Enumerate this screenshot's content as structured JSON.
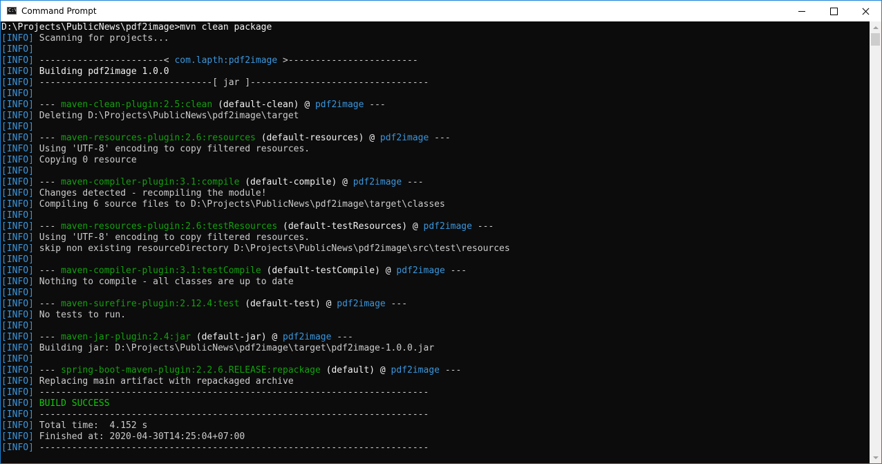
{
  "window": {
    "title": "Command Prompt",
    "icon_text": "C:\\",
    "icon_name": "command-prompt-icon"
  },
  "controls": {
    "minimize": "minimize-icon",
    "maximize": "maximize-icon",
    "close": "close-icon"
  },
  "colors": {
    "info": "#3a96dd",
    "plugin": "#13a10e",
    "artifact": "#3a96dd",
    "success": "#16c60c",
    "text": "#cccccc",
    "background": "#0c0c0c"
  },
  "console": {
    "lines": [
      [
        {
          "t": "D:\\Projects\\PublicNews\\pdf2image>mvn clean package",
          "c": "bright"
        }
      ],
      [
        {
          "t": "[INFO]",
          "c": "info"
        },
        {
          "t": " Scanning for projects...",
          "c": ""
        }
      ],
      [
        {
          "t": "[INFO]",
          "c": "info"
        }
      ],
      [
        {
          "t": "[INFO]",
          "c": "info"
        },
        {
          "t": " -----------------------< ",
          "c": ""
        },
        {
          "t": "com.lapth:pdf2image",
          "c": "artifact"
        },
        {
          "t": " >------------------------",
          "c": ""
        }
      ],
      [
        {
          "t": "[INFO]",
          "c": "info"
        },
        {
          "t": " Building pdf2image 1.0.0",
          "c": "bright"
        }
      ],
      [
        {
          "t": "[INFO]",
          "c": "info"
        },
        {
          "t": " --------------------------------[ jar ]---------------------------------",
          "c": ""
        }
      ],
      [
        {
          "t": "[INFO]",
          "c": "info"
        }
      ],
      [
        {
          "t": "[INFO]",
          "c": "info"
        },
        {
          "t": " --- ",
          "c": ""
        },
        {
          "t": "maven-clean-plugin:2.5:clean",
          "c": "plugin"
        },
        {
          "t": " (default-clean) @ ",
          "c": "bright"
        },
        {
          "t": "pdf2image",
          "c": "artifact"
        },
        {
          "t": " ---",
          "c": ""
        }
      ],
      [
        {
          "t": "[INFO]",
          "c": "info"
        },
        {
          "t": " Deleting D:\\Projects\\PublicNews\\pdf2image\\target",
          "c": ""
        }
      ],
      [
        {
          "t": "[INFO]",
          "c": "info"
        }
      ],
      [
        {
          "t": "[INFO]",
          "c": "info"
        },
        {
          "t": " --- ",
          "c": ""
        },
        {
          "t": "maven-resources-plugin:2.6:resources",
          "c": "plugin"
        },
        {
          "t": " (default-resources) @ ",
          "c": "bright"
        },
        {
          "t": "pdf2image",
          "c": "artifact"
        },
        {
          "t": " ---",
          "c": ""
        }
      ],
      [
        {
          "t": "[INFO]",
          "c": "info"
        },
        {
          "t": " Using 'UTF-8' encoding to copy filtered resources.",
          "c": ""
        }
      ],
      [
        {
          "t": "[INFO]",
          "c": "info"
        },
        {
          "t": " Copying 0 resource",
          "c": ""
        }
      ],
      [
        {
          "t": "[INFO]",
          "c": "info"
        }
      ],
      [
        {
          "t": "[INFO]",
          "c": "info"
        },
        {
          "t": " --- ",
          "c": ""
        },
        {
          "t": "maven-compiler-plugin:3.1:compile",
          "c": "plugin"
        },
        {
          "t": " (default-compile) @ ",
          "c": "bright"
        },
        {
          "t": "pdf2image",
          "c": "artifact"
        },
        {
          "t": " ---",
          "c": ""
        }
      ],
      [
        {
          "t": "[INFO]",
          "c": "info"
        },
        {
          "t": " Changes detected - recompiling the module!",
          "c": ""
        }
      ],
      [
        {
          "t": "[INFO]",
          "c": "info"
        },
        {
          "t": " Compiling 6 source files to D:\\Projects\\PublicNews\\pdf2image\\target\\classes",
          "c": ""
        }
      ],
      [
        {
          "t": "[INFO]",
          "c": "info"
        }
      ],
      [
        {
          "t": "[INFO]",
          "c": "info"
        },
        {
          "t": " --- ",
          "c": ""
        },
        {
          "t": "maven-resources-plugin:2.6:testResources",
          "c": "plugin"
        },
        {
          "t": " (default-testResources) @ ",
          "c": "bright"
        },
        {
          "t": "pdf2image",
          "c": "artifact"
        },
        {
          "t": " ---",
          "c": ""
        }
      ],
      [
        {
          "t": "[INFO]",
          "c": "info"
        },
        {
          "t": " Using 'UTF-8' encoding to copy filtered resources.",
          "c": ""
        }
      ],
      [
        {
          "t": "[INFO]",
          "c": "info"
        },
        {
          "t": " skip non existing resourceDirectory D:\\Projects\\PublicNews\\pdf2image\\src\\test\\resources",
          "c": ""
        }
      ],
      [
        {
          "t": "[INFO]",
          "c": "info"
        }
      ],
      [
        {
          "t": "[INFO]",
          "c": "info"
        },
        {
          "t": " --- ",
          "c": ""
        },
        {
          "t": "maven-compiler-plugin:3.1:testCompile",
          "c": "plugin"
        },
        {
          "t": " (default-testCompile) @ ",
          "c": "bright"
        },
        {
          "t": "pdf2image",
          "c": "artifact"
        },
        {
          "t": " ---",
          "c": ""
        }
      ],
      [
        {
          "t": "[INFO]",
          "c": "info"
        },
        {
          "t": " Nothing to compile - all classes are up to date",
          "c": ""
        }
      ],
      [
        {
          "t": "[INFO]",
          "c": "info"
        }
      ],
      [
        {
          "t": "[INFO]",
          "c": "info"
        },
        {
          "t": " --- ",
          "c": ""
        },
        {
          "t": "maven-surefire-plugin:2.12.4:test",
          "c": "plugin"
        },
        {
          "t": " (default-test) @ ",
          "c": "bright"
        },
        {
          "t": "pdf2image",
          "c": "artifact"
        },
        {
          "t": " ---",
          "c": ""
        }
      ],
      [
        {
          "t": "[INFO]",
          "c": "info"
        },
        {
          "t": " No tests to run.",
          "c": ""
        }
      ],
      [
        {
          "t": "[INFO]",
          "c": "info"
        }
      ],
      [
        {
          "t": "[INFO]",
          "c": "info"
        },
        {
          "t": " --- ",
          "c": ""
        },
        {
          "t": "maven-jar-plugin:2.4:jar",
          "c": "plugin"
        },
        {
          "t": " (default-jar) @ ",
          "c": "bright"
        },
        {
          "t": "pdf2image",
          "c": "artifact"
        },
        {
          "t": " ---",
          "c": ""
        }
      ],
      [
        {
          "t": "[INFO]",
          "c": "info"
        },
        {
          "t": " Building jar: D:\\Projects\\PublicNews\\pdf2image\\target\\pdf2image-1.0.0.jar",
          "c": ""
        }
      ],
      [
        {
          "t": "[INFO]",
          "c": "info"
        }
      ],
      [
        {
          "t": "[INFO]",
          "c": "info"
        },
        {
          "t": " --- ",
          "c": ""
        },
        {
          "t": "spring-boot-maven-plugin:2.2.6.RELEASE:repackage",
          "c": "plugin"
        },
        {
          "t": " (default) @ ",
          "c": "bright"
        },
        {
          "t": "pdf2image",
          "c": "artifact"
        },
        {
          "t": " ---",
          "c": ""
        }
      ],
      [
        {
          "t": "[INFO]",
          "c": "info"
        },
        {
          "t": " Replacing main artifact with repackaged archive",
          "c": ""
        }
      ],
      [
        {
          "t": "[INFO]",
          "c": "info"
        },
        {
          "t": " ------------------------------------------------------------------------",
          "c": ""
        }
      ],
      [
        {
          "t": "[INFO]",
          "c": "info"
        },
        {
          "t": " ",
          "c": ""
        },
        {
          "t": "BUILD SUCCESS",
          "c": "success"
        }
      ],
      [
        {
          "t": "[INFO]",
          "c": "info"
        },
        {
          "t": " ------------------------------------------------------------------------",
          "c": ""
        }
      ],
      [
        {
          "t": "[INFO]",
          "c": "info"
        },
        {
          "t": " Total time:  4.152 s",
          "c": ""
        }
      ],
      [
        {
          "t": "[INFO]",
          "c": "info"
        },
        {
          "t": " Finished at: 2020-04-30T14:25:04+07:00",
          "c": ""
        }
      ],
      [
        {
          "t": "[INFO]",
          "c": "info"
        },
        {
          "t": " ------------------------------------------------------------------------",
          "c": ""
        }
      ]
    ]
  }
}
